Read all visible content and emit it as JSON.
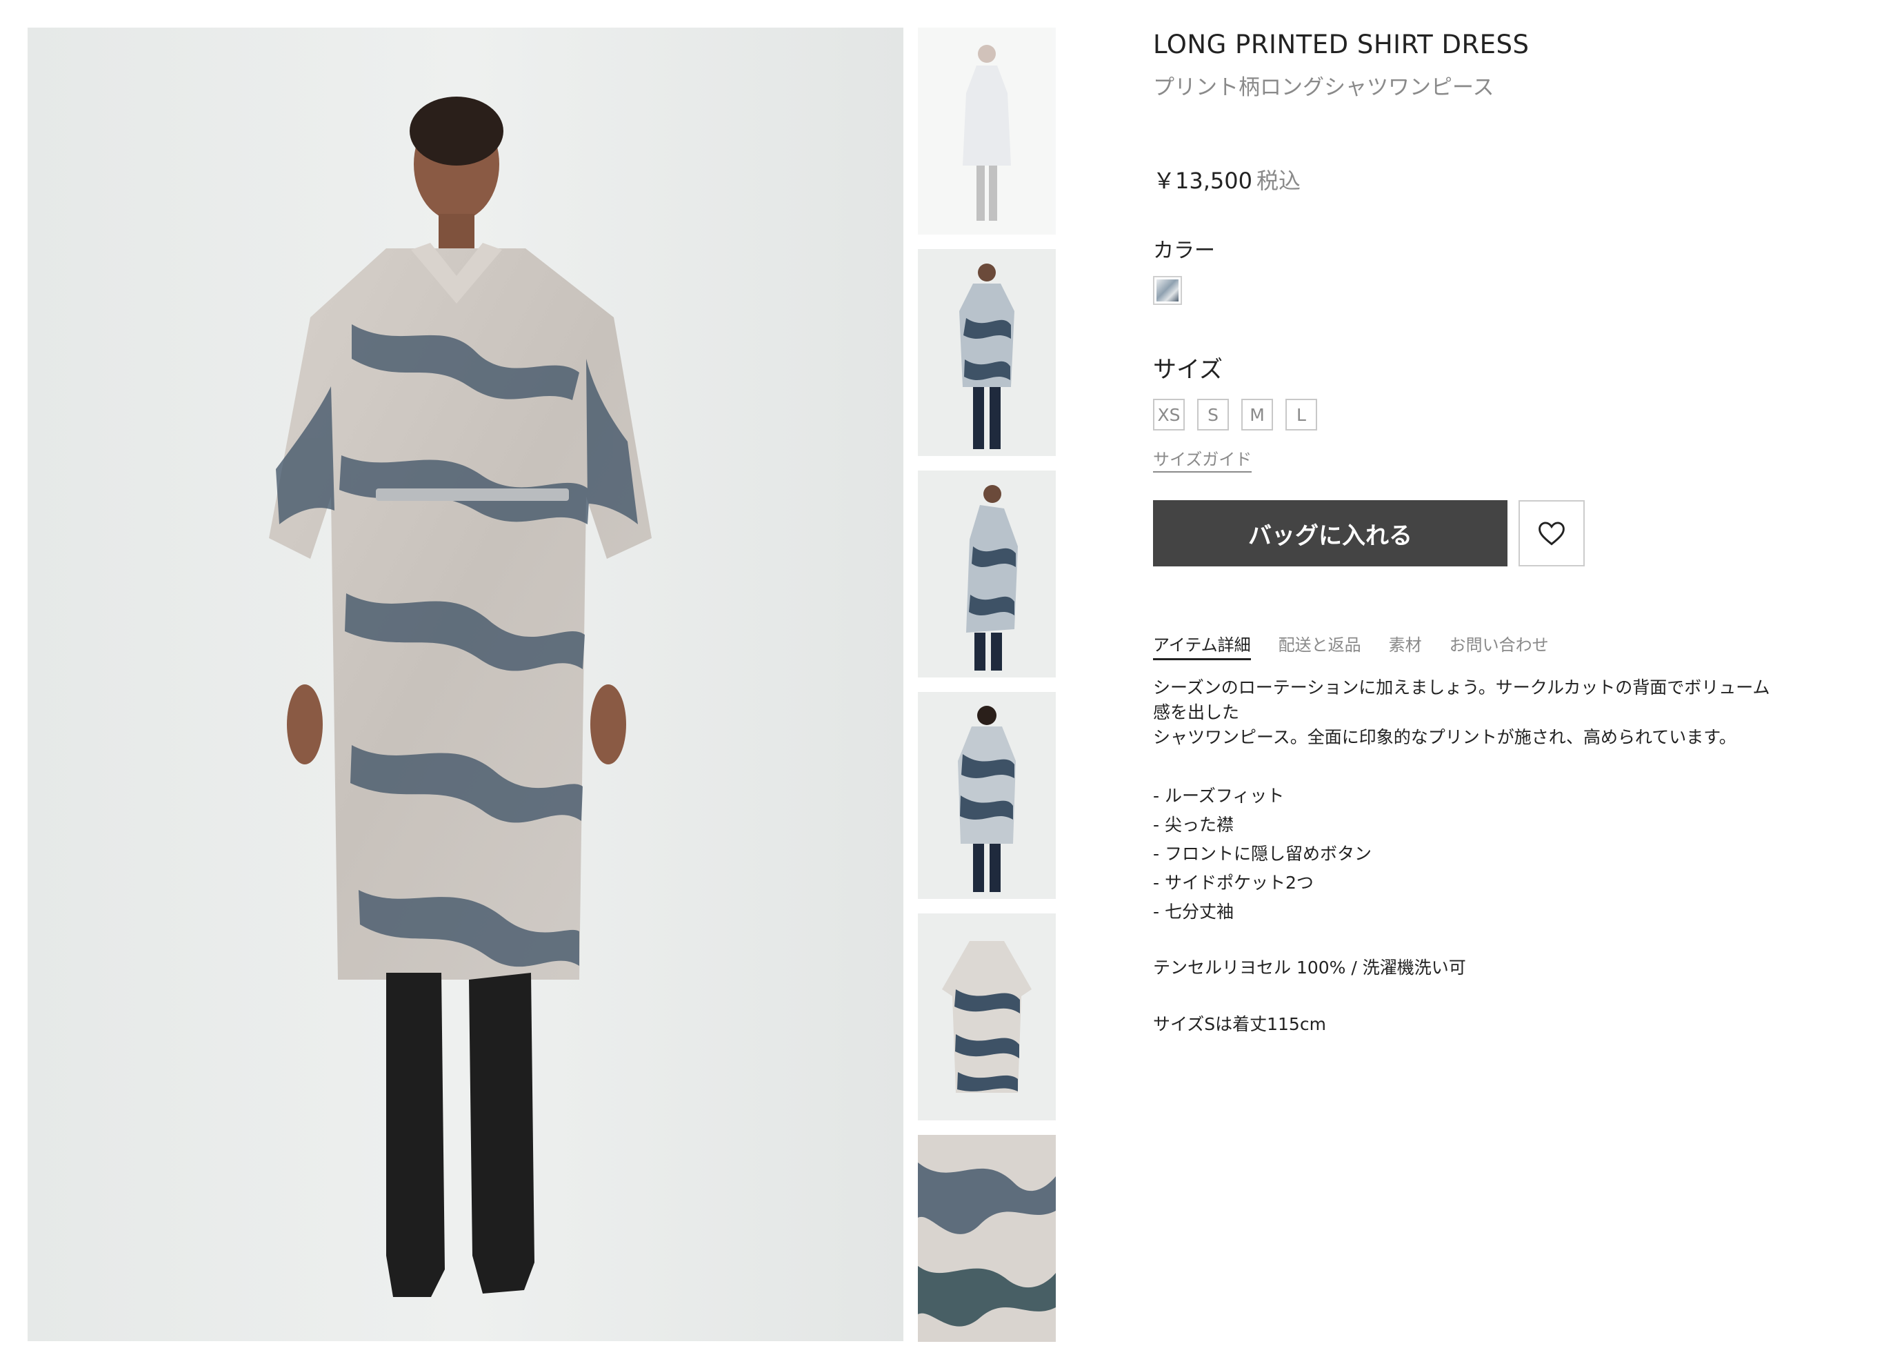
{
  "product": {
    "title": "LONG PRINTED SHIRT DRESS",
    "subtitle": "プリント柄ロングシャツワンピース",
    "price": "￥13,500",
    "tax_label": "税込"
  },
  "color": {
    "label": "カラー",
    "swatch_icon": "print-swatch",
    "swatch_colors": [
      "#e8ebee",
      "#8fa1b0",
      "#4e5f70"
    ]
  },
  "size": {
    "label": "サイズ",
    "options": [
      "XS",
      "S",
      "M",
      "L"
    ],
    "guide_label": "サイズガイド"
  },
  "actions": {
    "add_to_bag": "バッグに入れる",
    "favorite_icon": "heart-icon"
  },
  "tabs": [
    "アイテム詳細",
    "配送と返品",
    "素材",
    "お問い合わせ"
  ],
  "details": {
    "description_line1": "シーズンのローテーションに加えましょう。サークルカットの背面でボリューム感を出した",
    "description_line2": "シャツワンピース。全面に印象的なプリントが施され、高められています。",
    "features": [
      "- ルーズフィット",
      "- 尖った襟",
      "- フロントに隠し留めボタン",
      "- サイドポケット2つ",
      "- 七分丈袖"
    ],
    "material": "テンセルリヨセル 100% / 洗濯機洗い可",
    "length_note": "サイズSは着丈115cm"
  },
  "colors": {
    "button_dark": "#444444",
    "text_muted": "#8a8a8a",
    "dress_navy": "#3e5266",
    "dress_beige": "#cfc8c2"
  }
}
